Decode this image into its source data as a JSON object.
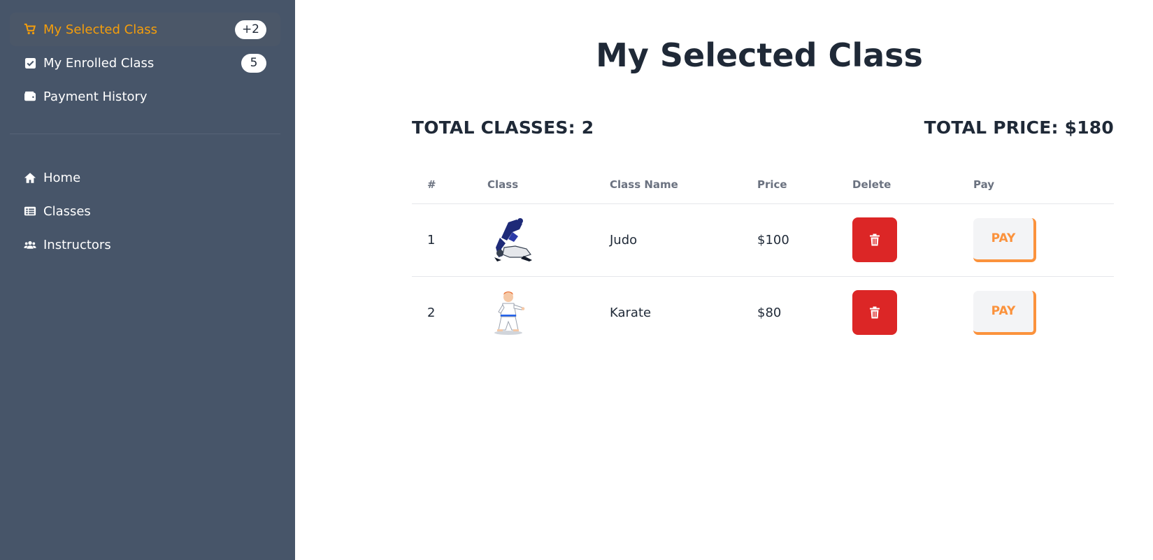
{
  "sidebar": {
    "items": [
      {
        "label": "My Selected Class",
        "badge": "+2",
        "icon": "cart-icon",
        "active": true
      },
      {
        "label": "My Enrolled Class",
        "badge": "5",
        "icon": "checkbox-icon"
      },
      {
        "label": "Payment History",
        "icon": "wallet-icon"
      }
    ],
    "nav": [
      {
        "label": "Home",
        "icon": "home-icon"
      },
      {
        "label": "Classes",
        "icon": "list-icon"
      },
      {
        "label": "Instructors",
        "icon": "users-icon"
      }
    ]
  },
  "main": {
    "title": "My Selected Class",
    "total_classes": "TOTAL CLASSES: 2",
    "total_price": "TOTAL PRICE: $180",
    "table": {
      "headers": [
        "#",
        "Class",
        "Class Name",
        "Price",
        "Delete",
        "Pay"
      ],
      "rows": [
        {
          "num": "1",
          "image": "judo-image",
          "name": "Judo",
          "price": "$100",
          "pay_label": "PAY"
        },
        {
          "num": "2",
          "image": "karate-image",
          "name": "Karate",
          "price": "$80",
          "pay_label": "PAY"
        }
      ]
    }
  },
  "colors": {
    "sidebar_bg": "#475569",
    "active_text": "#f59e0b",
    "delete_bg": "#dc2626",
    "pay_accent": "#fb923c"
  }
}
